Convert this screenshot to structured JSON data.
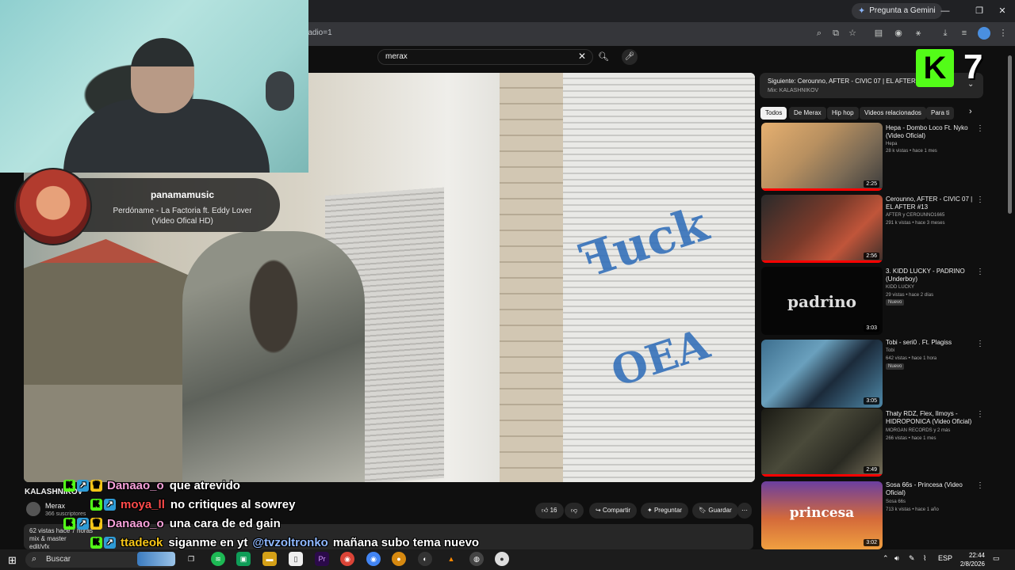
{
  "browser": {
    "gemini_label": "Pregunta a Gemini",
    "url_fragment": "radio=1"
  },
  "search": {
    "query": "merax"
  },
  "webcam_overlay": {
    "music_channel": "panamamusic",
    "music_song_line1": "Perdóname - La Factoria ft. Eddy Lover",
    "music_song_line2": "(Video Ofical HD)"
  },
  "chat": [
    {
      "user": "Danaao_o",
      "user_color": "#f5a0d8",
      "message": "que atrevido"
    },
    {
      "user": "moya_ll",
      "user_color": "#ff4b4b",
      "message": "no critiques al sowrey"
    },
    {
      "user": "Danaao_o",
      "user_color": "#f5a0d8",
      "message": "una cara de ed gain"
    },
    {
      "user": "ttadeok",
      "user_color": "#f5c518",
      "message": "siganme en yt",
      "mention": "@tvzoltronko",
      "message2": "mañana subo tema nuevo"
    }
  ],
  "video": {
    "title": "KALASHNIKOV",
    "channel": "Merax",
    "subscribers": "366 suscriptores",
    "views_time": "62 vistas  hace 7 horas",
    "desc_line2": "mix & master",
    "desc_line3": "edit/vfx",
    "likes": "16",
    "share": "Compartir",
    "ask": "Preguntar",
    "save": "Guardar"
  },
  "sidebar": {
    "next_title": "Siguiente: Cerounno, AFTER - CIVIC 07 | EL AFTER #13",
    "next_mix": "Mix: KALASHNIKOV",
    "k7_number": "7",
    "chips": [
      "Todos",
      "De Merax",
      "Hip hop",
      "Videos relacionados",
      "Para ti"
    ],
    "videos": [
      {
        "title": "Hepa - Dombo Loco Ft. Nyko (Video Oficial)",
        "channel": "Hepa",
        "meta": "28 k vistas • hace 1 mes",
        "duration": "2:25",
        "badge": ""
      },
      {
        "title": "Cerounno, AFTER - CIVIC 07 | EL AFTER #13",
        "channel": "AFTER y CEROUNNO1665",
        "meta": "291 k vistas • hace 3 meses",
        "duration": "2:56",
        "badge": ""
      },
      {
        "title": "3. KIDD LUCKY - PADRINO (Underboy)",
        "channel": "KIDD LUCKY",
        "meta": "29 vistas • hace 2 días",
        "duration": "3:03",
        "badge": "Nuevo",
        "thumb_text": "padrino"
      },
      {
        "title": "Tobi - seri0 . Ft. Plagiss",
        "channel": "Tobi",
        "meta": "642 vistas • hace 1 hora",
        "duration": "3:05",
        "badge": "Nuevo"
      },
      {
        "title": "Thaty RDZ, Flex, Ilmoys - HIDROPONICA (Video Oficial)",
        "channel": "MORGAN RECORDS y 2 más",
        "meta": "266 vistas • hace 1 mes",
        "duration": "2:49",
        "badge": ""
      },
      {
        "title": "Sosa 66s - Princesa (Video Oficial)",
        "channel": "Sosa 66s",
        "meta": "713 k vistas • hace 1 año",
        "duration": "3:02",
        "badge": "",
        "thumb_text": "princesa"
      }
    ]
  },
  "taskbar": {
    "search_placeholder": "Buscar",
    "lang": "ESP",
    "time": "22:44",
    "date": "2/8/2026"
  },
  "colors": {
    "kick_green": "#53fc18",
    "yt_red": "#ff0000"
  }
}
